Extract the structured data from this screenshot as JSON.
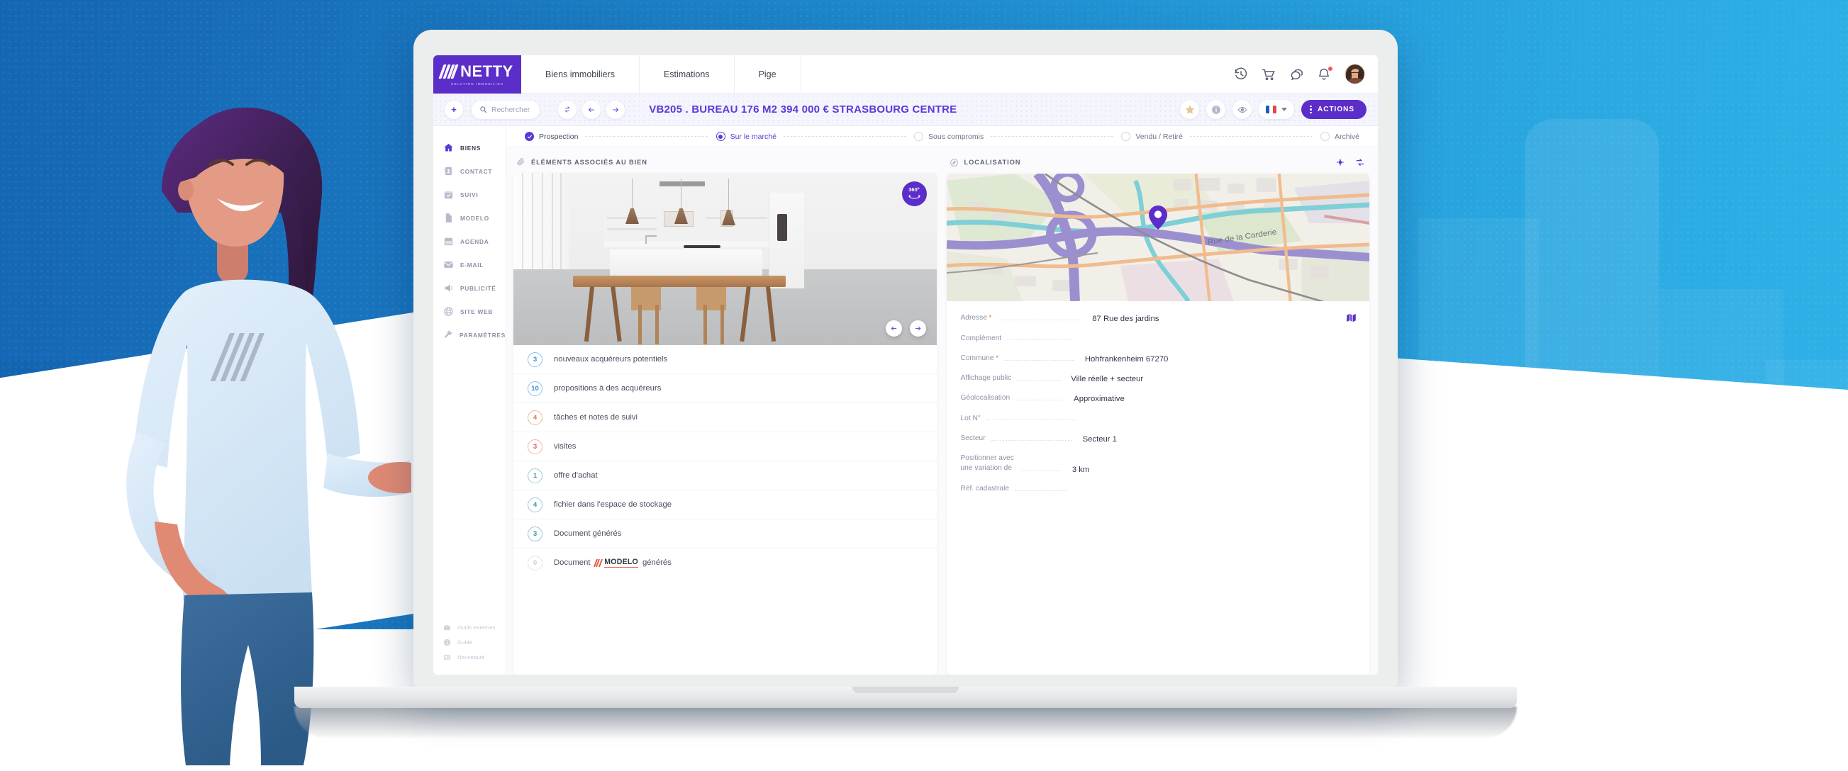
{
  "brand": {
    "name": "NETTY",
    "tagline": "SOLUTION IMMOBILIER",
    "primary_color": "#5b2ec9",
    "accent_color": "#5b3ad6"
  },
  "topnav": {
    "items": [
      {
        "label": "Biens immobiliers"
      },
      {
        "label": "Estimations"
      },
      {
        "label": "Pige"
      }
    ],
    "icons": [
      {
        "name": "history-icon"
      },
      {
        "name": "cart-icon"
      },
      {
        "name": "chat-icon"
      },
      {
        "name": "bell-icon"
      }
    ]
  },
  "actionbar": {
    "add_label": "+",
    "search_placeholder": "Rechercher",
    "nav": {
      "refresh": "refresh-icon",
      "back": "arrow-left-icon",
      "forward": "arrow-right-icon"
    },
    "deal_title": "VB205 . BUREAU 176 M2 394 000 €  STRASBOURG CENTRE",
    "right_icons": [
      {
        "name": "star-icon"
      },
      {
        "name": "info-icon"
      },
      {
        "name": "eye-icon"
      }
    ],
    "language": "fr",
    "actions_label": "ACTIONS"
  },
  "sidebar": {
    "items": [
      {
        "label": "BIENS",
        "icon": "home-icon",
        "active": true
      },
      {
        "label": "CONTACT",
        "icon": "contact-book-icon",
        "active": false
      },
      {
        "label": "SUIVI",
        "icon": "calendar-check-icon",
        "active": false
      },
      {
        "label": "MODELO",
        "icon": "document-icon",
        "active": false
      },
      {
        "label": "AGENDA",
        "icon": "calendar-icon",
        "active": false
      },
      {
        "label": "E-MAIL",
        "icon": "envelope-icon",
        "active": false
      },
      {
        "label": "PUBLICITÉ",
        "icon": "megaphone-icon",
        "active": false
      },
      {
        "label": "SITE WEB",
        "icon": "globe-icon",
        "active": false
      },
      {
        "label": "PARAMÈTRES",
        "icon": "wrench-icon",
        "active": false
      }
    ],
    "footer": [
      {
        "label": "Outils externes",
        "icon": "toolbox-icon"
      },
      {
        "label": "Guide",
        "icon": "info-icon"
      },
      {
        "label": "Nouveauté",
        "icon": "news-icon"
      }
    ]
  },
  "stepper": {
    "steps": [
      {
        "label": "Prospection",
        "state": "done"
      },
      {
        "label": "Sur le marché",
        "state": "current"
      },
      {
        "label": "Sous compromis",
        "state": "todo"
      },
      {
        "label": "Vendu / Retiré",
        "state": "todo"
      },
      {
        "label": "Archivé",
        "state": "todo"
      }
    ]
  },
  "left_panel": {
    "section_title": "ÉLÉMENTS ASSOCIÉS AU BIEN",
    "section_icon": "paperclip-icon",
    "photo": {
      "badge_360": "360°",
      "prev": "arrow-left-icon",
      "next": "arrow-right-icon"
    },
    "items": [
      {
        "count": "3",
        "label": "nouveaux acquéreurs potentiels",
        "color": "#3d8fd6"
      },
      {
        "count": "10",
        "label": "propositions à des acquéreurs",
        "color": "#3d8fd6"
      },
      {
        "count": "4",
        "label": "tâches et notes de suivi",
        "color": "#e07a4e"
      },
      {
        "count": "3",
        "label": "visites",
        "color": "#e05a4e"
      },
      {
        "count": "1",
        "label": "offre d'achat",
        "color": "#3b9aa8"
      },
      {
        "count": "4",
        "label": "fichier dans l'espace de stockage",
        "color": "#3b9aa8"
      },
      {
        "count": "3",
        "label": "Document générés",
        "color": "#3b8fa8"
      },
      {
        "count": "0",
        "label_before": "Document",
        "logo": "MODELO",
        "label_after": "générés",
        "color": "#c8ccd6"
      }
    ]
  },
  "right_panel": {
    "section_title": "LOCALISATION",
    "section_icon": "compass-icon",
    "header_icons": [
      {
        "name": "target-icon"
      },
      {
        "name": "refresh-icon"
      }
    ],
    "map": {
      "street_label": "Rue de la Corderie",
      "pin_color": "#5b2ec9"
    },
    "fields": [
      {
        "label": "Adresse",
        "required": true,
        "value": "87 Rue des jardins",
        "dash_width": 120,
        "trailing_icon": "map-pin-icon"
      },
      {
        "label": "Complément",
        "required": false,
        "value": "",
        "dash_width": 90
      },
      {
        "label": "Commune",
        "required": true,
        "value": "Hohfrankenheim 67270",
        "dash_width": 100
      },
      {
        "label": "Affichage public",
        "required": false,
        "value": "Ville réelle + secteur",
        "dash_width": 62
      },
      {
        "label": "Géolocalisation",
        "required": false,
        "value": "Approximative",
        "dash_width": 68
      },
      {
        "label": "Lot N°",
        "required": false,
        "value": "",
        "dash_width": 128
      },
      {
        "label": "Secteur",
        "required": false,
        "value": "Secteur 1",
        "dash_width": 115
      },
      {
        "label": "Positionner avec\nune variation de",
        "required": false,
        "value": "3 km",
        "dash_width": 60,
        "two_line": true
      },
      {
        "label": "Réf. cadastrale",
        "required": false,
        "value": "",
        "dash_width": 75
      }
    ]
  }
}
